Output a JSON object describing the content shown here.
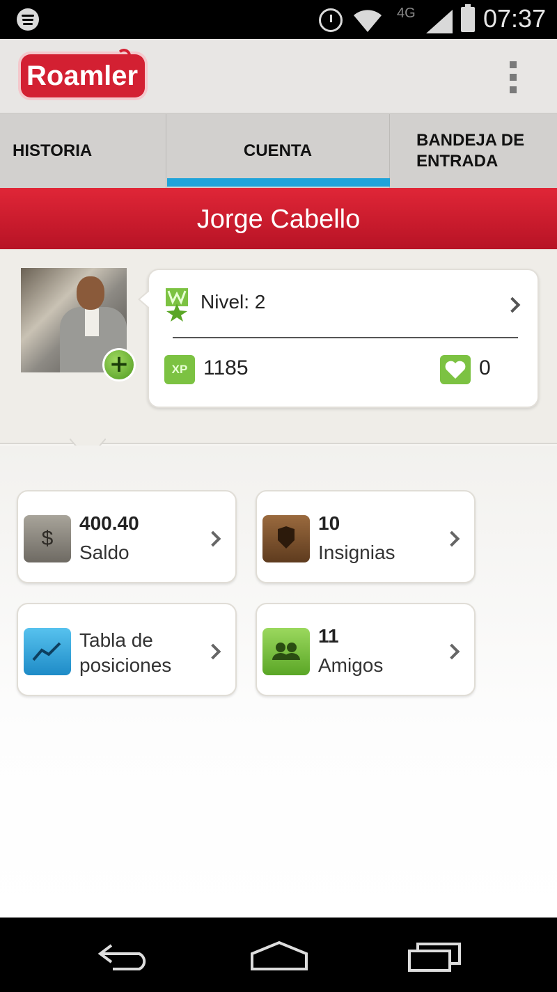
{
  "status_bar": {
    "network": "4G",
    "time": "07:37"
  },
  "app": {
    "logo_text": "Roamler"
  },
  "tabs": [
    {
      "label": "HISTORIA",
      "selected": false
    },
    {
      "label": "CUENTA",
      "selected": true
    },
    {
      "label": "BANDEJA DE ENTRADA",
      "selected": false
    }
  ],
  "profile": {
    "name": "Jorge Cabello",
    "level_label": "Nivel: 2",
    "xp_badge": "XP",
    "xp": "1185",
    "likes": "0"
  },
  "tiles": [
    {
      "value": "400.40",
      "label": "Saldo",
      "icon": "dollar-icon"
    },
    {
      "value": "10",
      "label": "Insignias",
      "icon": "badge-icon"
    },
    {
      "label": "Tabla de posiciones",
      "icon": "chart-icon"
    },
    {
      "value": "11",
      "label": "Amigos",
      "icon": "friends-icon"
    }
  ],
  "colors": {
    "brand_red": "#d32032",
    "tab_indicator": "#1fa3d9",
    "green": "#7cc242"
  }
}
